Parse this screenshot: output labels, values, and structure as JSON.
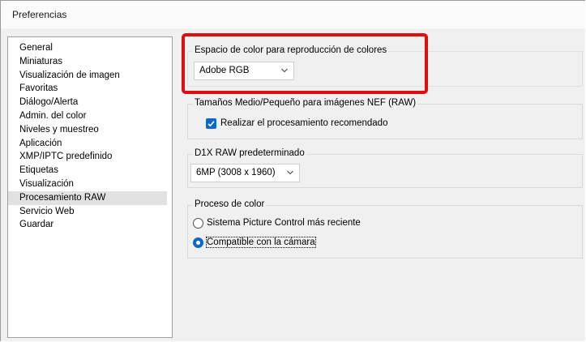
{
  "window": {
    "title": "Preferencias"
  },
  "sidebar": {
    "items": [
      {
        "label": "General"
      },
      {
        "label": "Miniaturas"
      },
      {
        "label": "Visualización de imagen"
      },
      {
        "label": "Favoritas"
      },
      {
        "label": "Diálogo/Alerta"
      },
      {
        "label": "Admin. del color"
      },
      {
        "label": "Niveles y muestreo"
      },
      {
        "label": "Aplicación"
      },
      {
        "label": "XMP/IPTC predefinido"
      },
      {
        "label": "Etiquetas"
      },
      {
        "label": "Visualización"
      },
      {
        "label": "Procesamiento RAW"
      },
      {
        "label": "Servicio Web"
      },
      {
        "label": "Guardar"
      }
    ],
    "selected": "Procesamiento RAW"
  },
  "color_space": {
    "title": "Espacio de color para reproducción de colores",
    "value": "Adobe RGB"
  },
  "nef_sizes": {
    "title": "Tamaños Medio/Pequeño para imágenes NEF (RAW)",
    "checkbox_label": "Realizar el procesamiento recomendado",
    "checked": true
  },
  "d1x_raw": {
    "title": "D1X RAW predeterminado",
    "value": "6MP (3008 x 1960)"
  },
  "color_process": {
    "title": "Proceso de color",
    "options": [
      {
        "label": "Sistema Picture Control más reciente",
        "selected": false
      },
      {
        "label": "Compatible con la cámara",
        "selected": true
      }
    ]
  },
  "colors": {
    "accent": "#0f68c8",
    "highlight": "#e10e0e"
  }
}
